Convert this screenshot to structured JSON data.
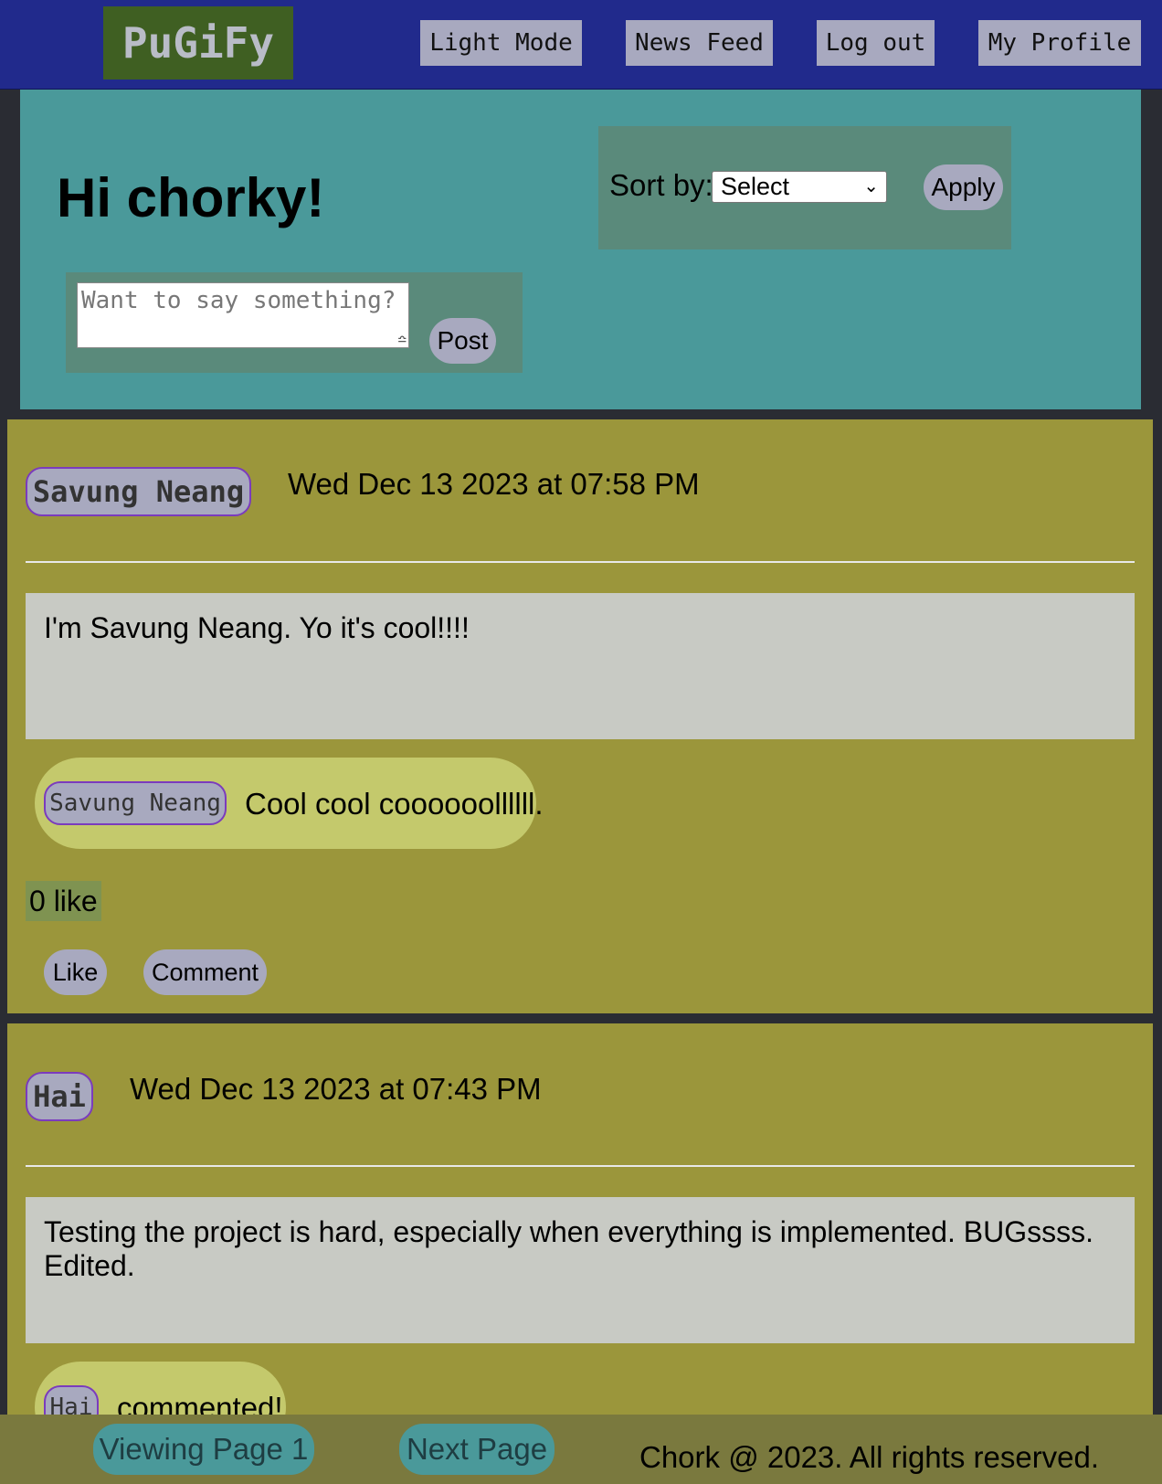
{
  "nav": {
    "logo": "PuGiFy",
    "light_mode": "Light Mode",
    "news_feed": "News Feed",
    "log_out": "Log out",
    "my_profile": "My Profile"
  },
  "header": {
    "greeting": "Hi chorky!",
    "sort_label": "Sort by:",
    "sort_selected": "Select",
    "apply_label": "Apply",
    "post_placeholder": "Want to say something?",
    "post_label": "Post"
  },
  "posts": [
    {
      "author": "Savung Neang",
      "date": "Wed Dec 13 2023 at 07:58 PM",
      "content": "I'm Savung Neang. Yo it's cool!!!!",
      "comments": [
        {
          "author": "Savung Neang",
          "text": "Cool cool coooooollllll."
        }
      ],
      "likes": "0 like",
      "like_label": "Like",
      "comment_label": "Comment"
    },
    {
      "author": "Hai",
      "date": "Wed Dec 13 2023 at 07:43 PM",
      "content": "Testing the project is hard, especially when everything is implemented. BUGssss. Edited.",
      "comments": [
        {
          "author": "Hai",
          "text": "commented!"
        }
      ]
    }
  ],
  "footer": {
    "viewing_page": "Viewing Page 1",
    "next_page": "Next Page",
    "copyright": "Chork @ 2023. All rights reserved."
  },
  "colors": {
    "nav_bg": "#212a8c",
    "logo_bg": "#3f5f22",
    "header_bg": "#4a999a",
    "post_bg": "#9b963b",
    "button_bg": "#a8a9bf",
    "author_border": "#7b3bbd",
    "footer_bg": "#7a793e"
  }
}
